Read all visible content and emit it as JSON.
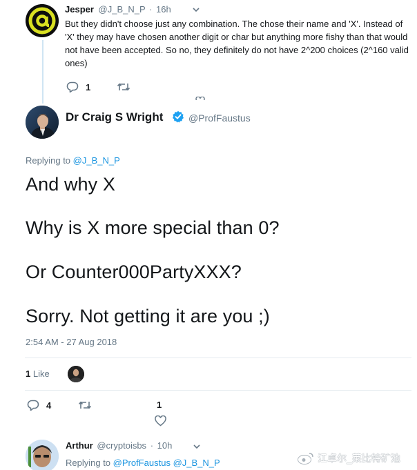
{
  "reply1": {
    "name": "Jesper",
    "handle": "@J_B_N_P",
    "sep": "·",
    "time": "16h",
    "text": "But they didn't choose just any combination. The chose their name and 'X'. Instead of 'X' they may have chosen another digit or char but anything more fishy than that would not have been accepted. So no, they definitely do not have 2^200 choices (2^160 valid ones)",
    "reply_count": "1"
  },
  "main": {
    "name": "Dr Craig S Wright",
    "handle": "@ProfFaustus",
    "replying_prefix": "Replying to",
    "replying_to": "@J_B_N_P",
    "lines": [
      "And why X",
      "Why is X more special than 0?",
      "Or Counter000PartyXXX?",
      "Sorry. Not getting it are you ;)"
    ],
    "timestamp": "2:54 AM - 27 Aug 2018",
    "likes_count": "1",
    "likes_label": "Like",
    "reply_count": "4",
    "like_count_action": "1"
  },
  "reply2": {
    "name": "Arthur",
    "handle": "@cryptoisbs",
    "sep": "·",
    "time": "10h",
    "replying_prefix": "Replying to",
    "replying_to_1": "@ProfFaustus",
    "replying_to_2": "@J_B_N_P"
  },
  "watermark": "江卓尔_莱比特矿池",
  "colors": {
    "link": "#1b95e0",
    "verified": "#1da1f2",
    "gray": "#657786"
  }
}
